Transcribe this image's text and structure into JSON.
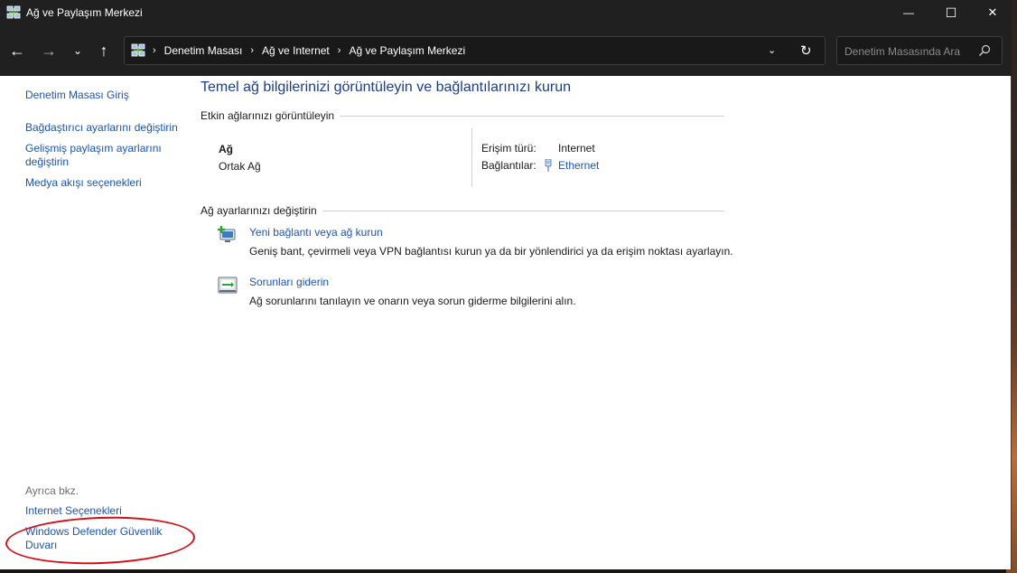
{
  "window": {
    "title": "Ağ ve Paylaşım Merkezi",
    "controls": {
      "minimize": "—",
      "maximize": "☐",
      "close": "✕"
    }
  },
  "nav": {
    "back": "←",
    "forward": "→",
    "recent": "⌄",
    "up": "↑"
  },
  "address": {
    "breadcrumbs": [
      "Denetim Masası",
      "Ağ ve Internet",
      "Ağ ve Paylaşım Merkezi"
    ],
    "separator": "›",
    "dropdown": "⌄",
    "refresh": "↻"
  },
  "search": {
    "placeholder": "Denetim Masasında Ara"
  },
  "sidebar": {
    "home": "Denetim Masası Giriş",
    "items": [
      "Bağdaştırıcı ayarlarını değiştirin",
      "Gelişmiş paylaşım ayarlarını değiştirin",
      "Medya akışı seçenekleri"
    ],
    "see_also": {
      "title": "Ayrıca bkz.",
      "items": [
        "Internet Seçenekleri",
        "Windows Defender Güvenlik Duvarı"
      ]
    }
  },
  "main": {
    "title": "Temel ağ bilgilerinizi görüntüleyin ve bağlantılarınızı kurun",
    "active_networks": {
      "heading": "Etkin ağlarınızı görüntüleyin",
      "network_name": "Ağ",
      "network_type": "Ortak Ağ",
      "access_type_label": "Erişim türü:",
      "access_type_value": "Internet",
      "connections_label": "Bağlantılar:",
      "connections_value": "Ethernet"
    },
    "change_settings": {
      "heading": "Ağ ayarlarınızı değiştirin",
      "tasks": [
        {
          "link": "Yeni bağlantı veya ağ kurun",
          "description": "Geniş bant, çevirmeli veya VPN bağlantısı kurun ya da bir yönlendirici ya da erişim noktası ayarlayın."
        },
        {
          "link": "Sorunları giderin",
          "description": "Ağ sorunlarını tanılayın ve onarın veya sorun giderme bilgilerini alın."
        }
      ]
    }
  },
  "colors": {
    "link": "#1b55b0",
    "title_blue": "#1a3e8c",
    "chrome_dark": "#202020",
    "annotation_red": "#d0101a"
  }
}
